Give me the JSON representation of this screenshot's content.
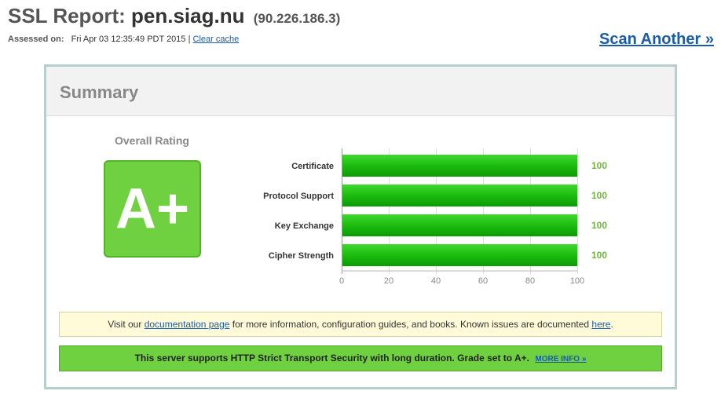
{
  "header": {
    "title_label": "SSL Report:",
    "host": "pen.siag.nu",
    "ip": "(90.226.186.3)",
    "assessed_label": "Assessed on:",
    "assessed_date": "Fri Apr 03 12:35:49 PDT 2015",
    "separator": "|",
    "clear_cache": "Clear cache",
    "scan_another": "Scan Another »"
  },
  "summary": {
    "title": "Summary",
    "overall_label": "Overall Rating",
    "grade": "A+",
    "grade_color": "#6fd13f"
  },
  "chart_data": {
    "type": "bar",
    "orientation": "horizontal",
    "categories": [
      "Certificate",
      "Protocol Support",
      "Key Exchange",
      "Cipher Strength"
    ],
    "values": [
      100,
      100,
      100,
      100
    ],
    "xlim": [
      0,
      100
    ],
    "xticks": [
      0,
      20,
      40,
      60,
      80,
      100
    ],
    "bar_color": "#1cbc0f",
    "grid": true
  },
  "notices": {
    "doc_prefix": "Visit our",
    "doc_link": "documentation page",
    "doc_middle": "for more information, configuration guides, and books. Known issues are documented",
    "doc_here": "here",
    "doc_end": ".",
    "hsts_text": "This server supports HTTP Strict Transport Security with long duration. Grade set to A+.",
    "hsts_link": "MORE INFO »"
  }
}
